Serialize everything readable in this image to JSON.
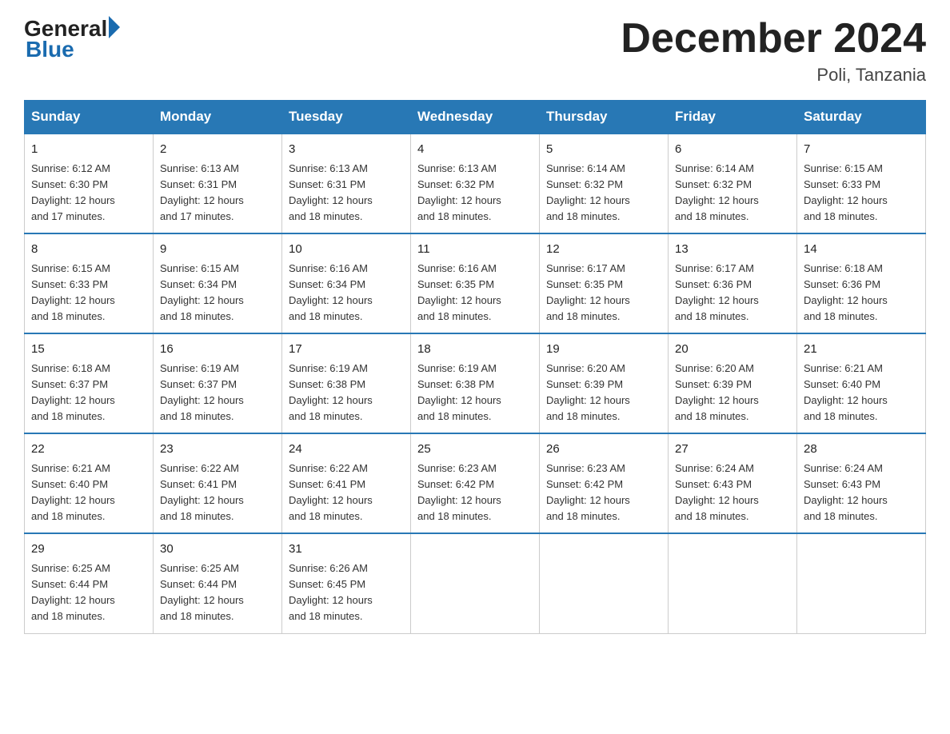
{
  "header": {
    "logo_general": "General",
    "logo_blue": "Blue",
    "month_title": "December 2024",
    "location": "Poli, Tanzania"
  },
  "weekdays": [
    "Sunday",
    "Monday",
    "Tuesday",
    "Wednesday",
    "Thursday",
    "Friday",
    "Saturday"
  ],
  "weeks": [
    [
      {
        "day": "1",
        "sunrise": "6:12 AM",
        "sunset": "6:30 PM",
        "daylight": "12 hours and 17 minutes."
      },
      {
        "day": "2",
        "sunrise": "6:13 AM",
        "sunset": "6:31 PM",
        "daylight": "12 hours and 17 minutes."
      },
      {
        "day": "3",
        "sunrise": "6:13 AM",
        "sunset": "6:31 PM",
        "daylight": "12 hours and 18 minutes."
      },
      {
        "day": "4",
        "sunrise": "6:13 AM",
        "sunset": "6:32 PM",
        "daylight": "12 hours and 18 minutes."
      },
      {
        "day": "5",
        "sunrise": "6:14 AM",
        "sunset": "6:32 PM",
        "daylight": "12 hours and 18 minutes."
      },
      {
        "day": "6",
        "sunrise": "6:14 AM",
        "sunset": "6:32 PM",
        "daylight": "12 hours and 18 minutes."
      },
      {
        "day": "7",
        "sunrise": "6:15 AM",
        "sunset": "6:33 PM",
        "daylight": "12 hours and 18 minutes."
      }
    ],
    [
      {
        "day": "8",
        "sunrise": "6:15 AM",
        "sunset": "6:33 PM",
        "daylight": "12 hours and 18 minutes."
      },
      {
        "day": "9",
        "sunrise": "6:15 AM",
        "sunset": "6:34 PM",
        "daylight": "12 hours and 18 minutes."
      },
      {
        "day": "10",
        "sunrise": "6:16 AM",
        "sunset": "6:34 PM",
        "daylight": "12 hours and 18 minutes."
      },
      {
        "day": "11",
        "sunrise": "6:16 AM",
        "sunset": "6:35 PM",
        "daylight": "12 hours and 18 minutes."
      },
      {
        "day": "12",
        "sunrise": "6:17 AM",
        "sunset": "6:35 PM",
        "daylight": "12 hours and 18 minutes."
      },
      {
        "day": "13",
        "sunrise": "6:17 AM",
        "sunset": "6:36 PM",
        "daylight": "12 hours and 18 minutes."
      },
      {
        "day": "14",
        "sunrise": "6:18 AM",
        "sunset": "6:36 PM",
        "daylight": "12 hours and 18 minutes."
      }
    ],
    [
      {
        "day": "15",
        "sunrise": "6:18 AM",
        "sunset": "6:37 PM",
        "daylight": "12 hours and 18 minutes."
      },
      {
        "day": "16",
        "sunrise": "6:19 AM",
        "sunset": "6:37 PM",
        "daylight": "12 hours and 18 minutes."
      },
      {
        "day": "17",
        "sunrise": "6:19 AM",
        "sunset": "6:38 PM",
        "daylight": "12 hours and 18 minutes."
      },
      {
        "day": "18",
        "sunrise": "6:19 AM",
        "sunset": "6:38 PM",
        "daylight": "12 hours and 18 minutes."
      },
      {
        "day": "19",
        "sunrise": "6:20 AM",
        "sunset": "6:39 PM",
        "daylight": "12 hours and 18 minutes."
      },
      {
        "day": "20",
        "sunrise": "6:20 AM",
        "sunset": "6:39 PM",
        "daylight": "12 hours and 18 minutes."
      },
      {
        "day": "21",
        "sunrise": "6:21 AM",
        "sunset": "6:40 PM",
        "daylight": "12 hours and 18 minutes."
      }
    ],
    [
      {
        "day": "22",
        "sunrise": "6:21 AM",
        "sunset": "6:40 PM",
        "daylight": "12 hours and 18 minutes."
      },
      {
        "day": "23",
        "sunrise": "6:22 AM",
        "sunset": "6:41 PM",
        "daylight": "12 hours and 18 minutes."
      },
      {
        "day": "24",
        "sunrise": "6:22 AM",
        "sunset": "6:41 PM",
        "daylight": "12 hours and 18 minutes."
      },
      {
        "day": "25",
        "sunrise": "6:23 AM",
        "sunset": "6:42 PM",
        "daylight": "12 hours and 18 minutes."
      },
      {
        "day": "26",
        "sunrise": "6:23 AM",
        "sunset": "6:42 PM",
        "daylight": "12 hours and 18 minutes."
      },
      {
        "day": "27",
        "sunrise": "6:24 AM",
        "sunset": "6:43 PM",
        "daylight": "12 hours and 18 minutes."
      },
      {
        "day": "28",
        "sunrise": "6:24 AM",
        "sunset": "6:43 PM",
        "daylight": "12 hours and 18 minutes."
      }
    ],
    [
      {
        "day": "29",
        "sunrise": "6:25 AM",
        "sunset": "6:44 PM",
        "daylight": "12 hours and 18 minutes."
      },
      {
        "day": "30",
        "sunrise": "6:25 AM",
        "sunset": "6:44 PM",
        "daylight": "12 hours and 18 minutes."
      },
      {
        "day": "31",
        "sunrise": "6:26 AM",
        "sunset": "6:45 PM",
        "daylight": "12 hours and 18 minutes."
      },
      null,
      null,
      null,
      null
    ]
  ]
}
